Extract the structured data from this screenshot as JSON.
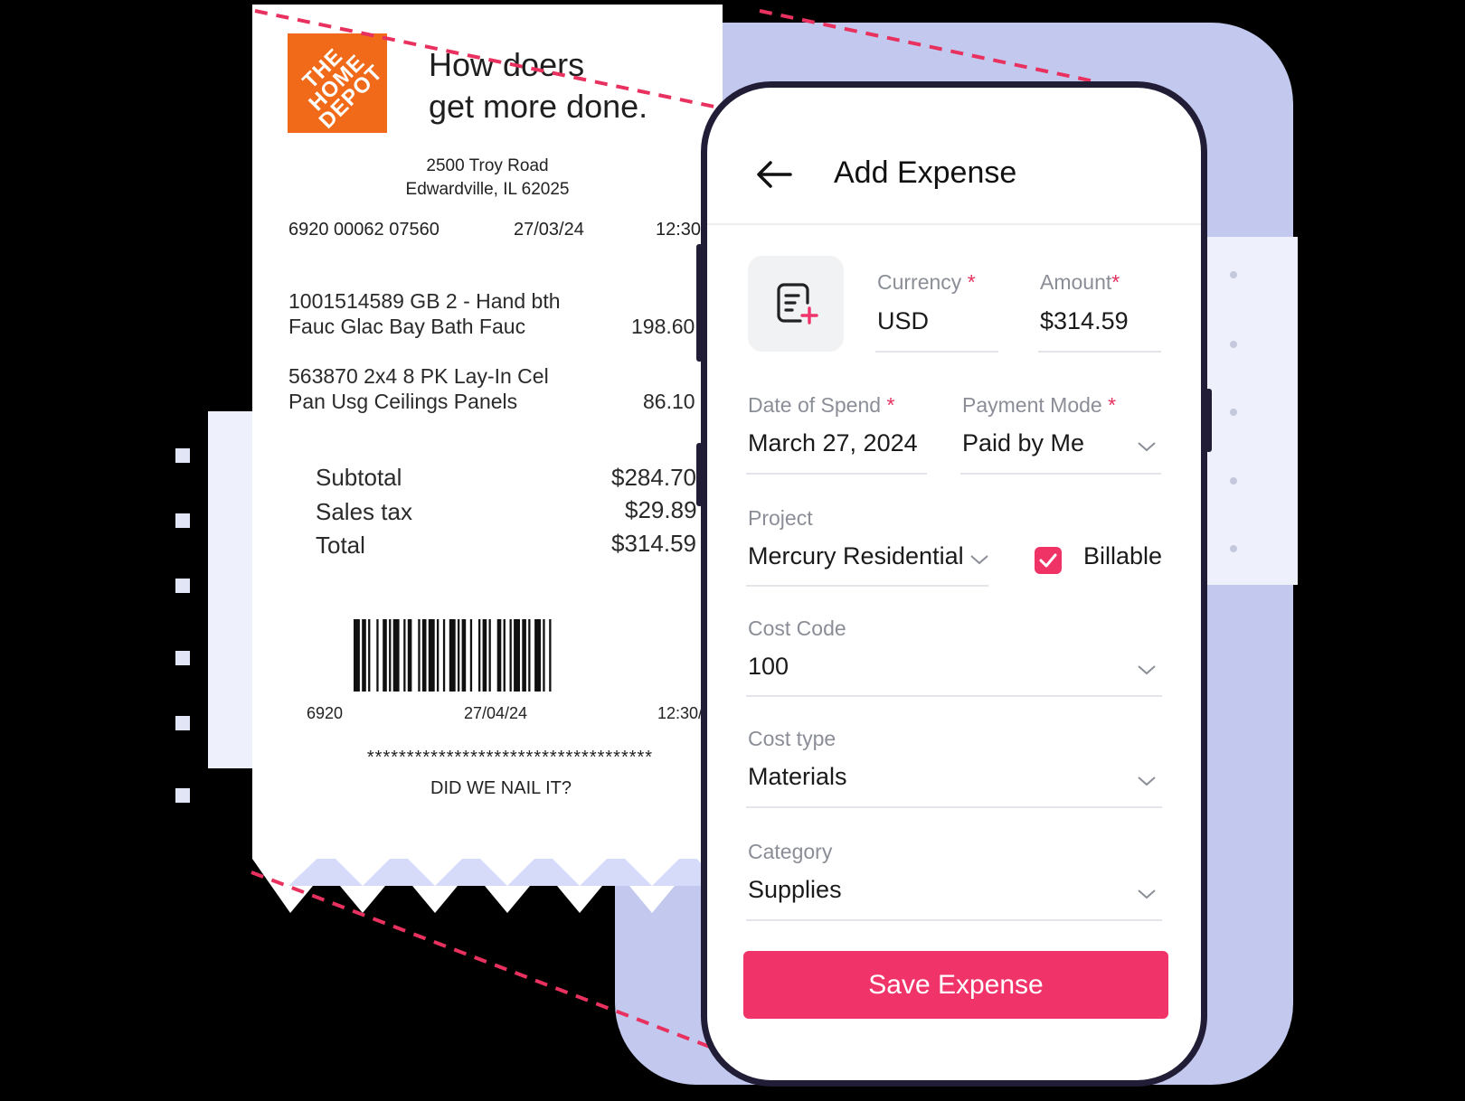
{
  "receipt": {
    "logo": "THE HOME DEPOT",
    "tagline": "How doers\nget more done.",
    "address_line1": "2500 Troy Road",
    "address_line2": "Edwardville, IL 62025",
    "header_code": "6920 00062 07560",
    "header_date": "27/03/24",
    "header_time": "12:30",
    "items": [
      {
        "line1": "1001514589 GB 2 - Hand bth",
        "line2": "Fauc Glac Bay Bath Fauc",
        "price": "198.60"
      },
      {
        "line1": "563870 2x4 8 PK Lay-In Cel",
        "line2": "Pan Usg Ceilings Panels",
        "price": "86.10"
      }
    ],
    "totals": [
      {
        "label": "Subtotal",
        "value": "$284.70"
      },
      {
        "label": "Sales tax",
        "value": "$29.89"
      },
      {
        "label": "Total",
        "value": "$314.59"
      }
    ],
    "barcode_left": "6920",
    "barcode_date": "27/04/24",
    "barcode_time": "12:30/",
    "stars": "************************************",
    "footer": "DID WE NAIL IT?"
  },
  "form": {
    "title": "Add Expense",
    "back_icon": "arrow-left-icon",
    "receipt_icon": "receipt-add-icon",
    "currency_label": "Currency",
    "currency_value": "USD",
    "amount_label": "Amount",
    "amount_value": "$314.59",
    "required_mark": "*",
    "date_label": "Date of Spend",
    "date_value": "March 27, 2024",
    "payment_label": "Payment Mode",
    "payment_value": "Paid by Me",
    "project_label": "Project",
    "project_value": "Mercury Residential",
    "billable_label": "Billable",
    "billable_checked": true,
    "cost_code_label": "Cost Code",
    "cost_code_value": "100",
    "cost_type_label": "Cost type",
    "cost_type_value": "Materials",
    "category_label": "Category",
    "category_value": "Supplies",
    "save_label": "Save Expense"
  },
  "colors": {
    "accent": "#f0346a",
    "logo_orange": "#f06a1a",
    "phone_frame": "#221d36",
    "glow": "#cdd3fb"
  }
}
